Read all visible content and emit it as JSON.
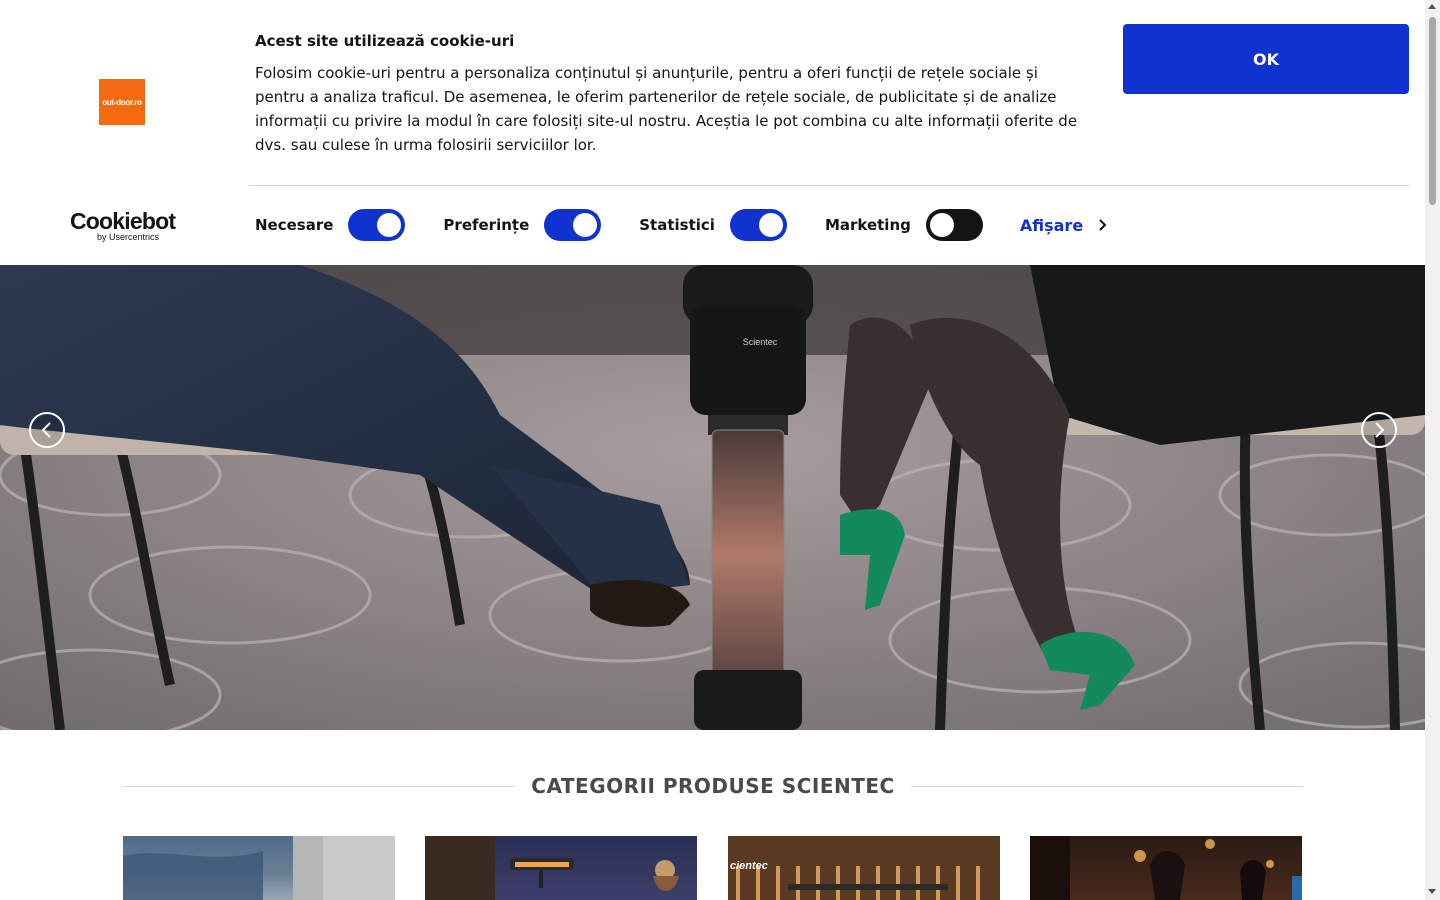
{
  "cookie_banner": {
    "site_logo_text": "out-door.ro",
    "cookiebot_name": "Cookiebot",
    "cookiebot_by": "by Usercentrics",
    "title": "Acest site utilizează cookie-uri",
    "text": "Folosim cookie-uri pentru a personaliza conținutul și anunțurile, pentru a oferi funcții de rețele sociale și pentru a analiza traficul. De asemenea, le oferim partenerilor de rețele sociale, de publicitate și de analize informații cu privire la modul în care folosiți site-ul nostru. Aceștia le pot combina cu alte informații oferite de dvs. sau culese în urma folosirii serviciilor lor.",
    "ok_label": "OK",
    "toggles": [
      {
        "label": "Necesare",
        "state": "on"
      },
      {
        "label": "Preferințe",
        "state": "on"
      },
      {
        "label": "Statistici",
        "state": "on"
      },
      {
        "label": "Marketing",
        "state": "off"
      }
    ],
    "details_label": "Afișare",
    "accent_color": "#1032cf"
  },
  "hero": {
    "heater_brand": "Scientec",
    "prev_icon": "chevron-left-icon",
    "next_icon": "chevron-right-icon"
  },
  "categories": {
    "title": "CATEGORII PRODUSE SCIENTEC",
    "cards": [
      {
        "name": "category-card-1",
        "brand": ""
      },
      {
        "name": "category-card-2",
        "brand": ""
      },
      {
        "name": "category-card-3",
        "brand": "cientec"
      },
      {
        "name": "category-card-4",
        "brand": ""
      }
    ]
  }
}
